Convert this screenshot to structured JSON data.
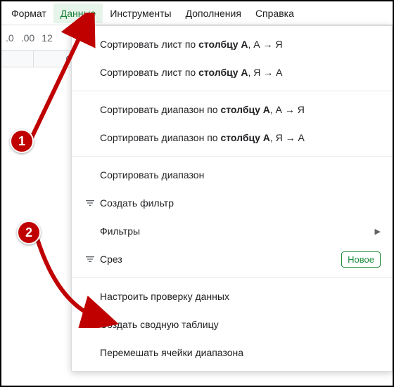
{
  "menubar": {
    "items": [
      "Формат",
      "Данные",
      "Инструменты",
      "Дополнения",
      "Справка"
    ],
    "active_index": 1
  },
  "toolbar": {
    "dec0": ".0",
    "dec00": ".00",
    "num": "12"
  },
  "col_headers": [
    "C"
  ],
  "dropdown": {
    "items": [
      {
        "label_pre": "Сортировать лист по ",
        "label_bold": "столбцу A",
        "label_post": ", А → Я",
        "icon": "",
        "interact": true
      },
      {
        "label_pre": "Сортировать лист по ",
        "label_bold": "столбцу A",
        "label_post": ", Я → А",
        "icon": "",
        "interact": true
      },
      {
        "sep": true
      },
      {
        "label_pre": "Сортировать диапазон по ",
        "label_bold": "столбцу A",
        "label_post": ", А → Я",
        "icon": "",
        "interact": true
      },
      {
        "label_pre": "Сортировать диапазон по ",
        "label_bold": "столбцу A",
        "label_post": ", Я → А",
        "icon": "",
        "interact": true
      },
      {
        "sep": true
      },
      {
        "label": "Сортировать диапазон",
        "icon": "",
        "interact": true
      },
      {
        "label": "Создать фильтр",
        "icon": "filter",
        "interact": true
      },
      {
        "label": "Фильтры",
        "icon": "",
        "submenu": true,
        "interact": true
      },
      {
        "label": "Срез",
        "icon": "slicer",
        "badge": "Новое",
        "interact": true
      },
      {
        "sep": true
      },
      {
        "label": "Настроить проверку данных",
        "icon": "",
        "interact": true
      },
      {
        "label": "Создать сводную таблицу",
        "icon": "",
        "interact": true
      },
      {
        "label": "Перемешать ячейки диапазона",
        "icon": "",
        "interact": true
      }
    ]
  },
  "callouts": {
    "one": "1",
    "two": "2"
  },
  "colors": {
    "accent_green": "#1e8e3e",
    "callout_red": "#c00000"
  }
}
